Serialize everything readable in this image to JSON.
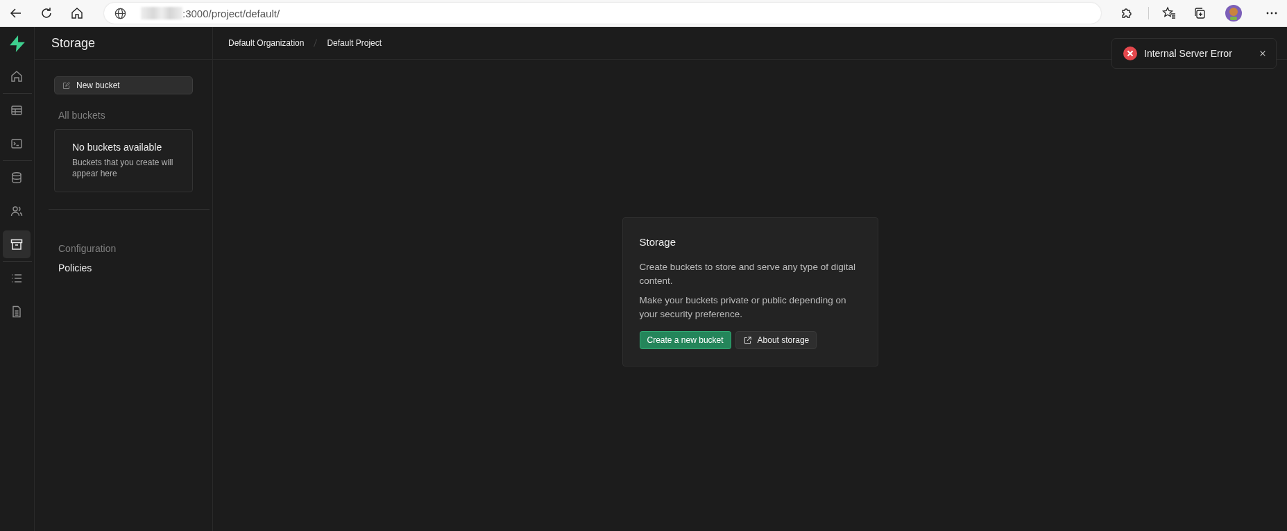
{
  "browser": {
    "url": ":3000/project/default/"
  },
  "rail": {
    "groups": [
      {
        "items": [
          {
            "kind": "home",
            "selected": false
          }
        ]
      },
      {
        "items": [
          {
            "kind": "table",
            "selected": false
          },
          {
            "kind": "terminal",
            "selected": false
          }
        ]
      },
      {
        "items": [
          {
            "kind": "database",
            "selected": false
          },
          {
            "kind": "users",
            "selected": false
          },
          {
            "kind": "archive",
            "selected": true
          }
        ]
      },
      {
        "items": [
          {
            "kind": "list",
            "selected": false
          },
          {
            "kind": "document",
            "selected": false
          }
        ]
      }
    ]
  },
  "sidebar": {
    "title": "Storage",
    "new_button": "New bucket",
    "section": "All buckets",
    "empty": {
      "title": "No buckets available",
      "text": "Buckets that you create will appear here"
    },
    "config_heading": "Configuration",
    "config_items": [
      {
        "label": "Policies",
        "selected": false
      }
    ]
  },
  "breadcrumb": [
    "Default Organization",
    "Default Project"
  ],
  "card": {
    "title": "Storage",
    "paragraphs": [
      "Create buckets to store and serve any type of digital content.",
      "Make your buckets private or public depending on your security preference."
    ],
    "primary_button": "Create a new bucket",
    "secondary_button": "About storage"
  },
  "toast": {
    "message": "Internal Server Error"
  }
}
